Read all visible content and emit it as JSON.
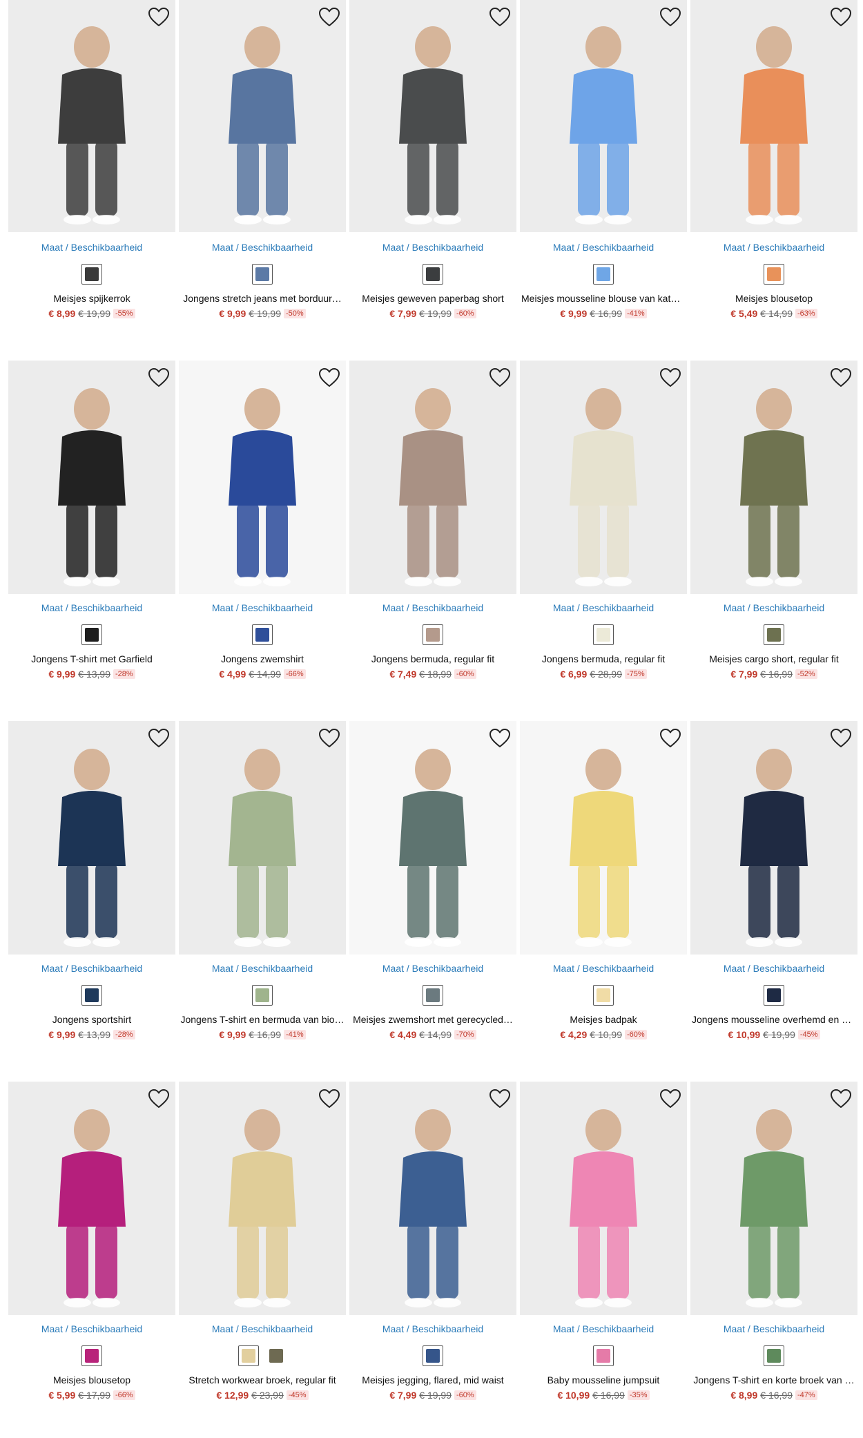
{
  "size_link_label": "Maat / Beschikbaarheid",
  "colors": {
    "link": "#2b7bb9",
    "sale_price": "#c0392b",
    "discount_bg": "#fbe3e3"
  },
  "products": [
    {
      "title": "Meisjes spijkerrok",
      "price": "€ 8,99",
      "old_price": "€ 19,99",
      "discount": "-55%",
      "swatches": [
        "#3a3a3a"
      ],
      "bg": "#ececec",
      "fg": "#3d3d3d"
    },
    {
      "title": "Jongens stretch jeans met borduur…",
      "price": "€ 9,99",
      "old_price": "€ 19,99",
      "discount": "-50%",
      "swatches": [
        "#5c7aa6"
      ],
      "bg": "#ededed",
      "fg": "#5875a0"
    },
    {
      "title": "Meisjes geweven paperbag short",
      "price": "€ 7,99",
      "old_price": "€ 19,99",
      "discount": "-60%",
      "swatches": [
        "#3b3d3f"
      ],
      "bg": "#ececec",
      "fg": "#4a4c4d"
    },
    {
      "title": "Meisjes mousseline blouse van katoen",
      "price": "€ 9,99",
      "old_price": "€ 16,99",
      "discount": "-41%",
      "swatches": [
        "#6fa6e6"
      ],
      "bg": "#ececec",
      "fg": "#6ea4e8"
    },
    {
      "title": "Meisjes blousetop",
      "price": "€ 5,49",
      "old_price": "€ 14,99",
      "discount": "-63%",
      "swatches": [
        "#e8925a"
      ],
      "bg": "#ececec",
      "fg": "#e98f5a"
    },
    {
      "title": "Jongens T-shirt met Garfield",
      "price": "€ 9,99",
      "old_price": "€ 13,99",
      "discount": "-28%",
      "swatches": [
        "#1e1e1e"
      ],
      "bg": "#ececec",
      "fg": "#222222"
    },
    {
      "title": "Jongens zwemshirt",
      "price": "€ 4,99",
      "old_price": "€ 14,99",
      "discount": "-66%",
      "swatches": [
        "#2f4f9a"
      ],
      "bg": "#f6f6f6",
      "fg": "#2a4a9a"
    },
    {
      "title": "Jongens bermuda, regular fit",
      "price": "€ 7,49",
      "old_price": "€ 18,99",
      "discount": "-60%",
      "swatches": [
        "#b49a8c"
      ],
      "bg": "#ececec",
      "fg": "#a99184"
    },
    {
      "title": "Jongens bermuda, regular fit",
      "price": "€ 6,99",
      "old_price": "€ 28,99",
      "discount": "-75%",
      "swatches": [
        "#ecead8"
      ],
      "bg": "#ececec",
      "fg": "#e6e2cf"
    },
    {
      "title": "Meisjes cargo short, regular fit",
      "price": "€ 7,99",
      "old_price": "€ 16,99",
      "discount": "-52%",
      "swatches": [
        "#6d7150"
      ],
      "bg": "#ececec",
      "fg": "#6f7350"
    },
    {
      "title": "Jongens sportshirt",
      "price": "€ 9,99",
      "old_price": "€ 13,99",
      "discount": "-28%",
      "swatches": [
        "#1f3a5c"
      ],
      "bg": "#ececec",
      "fg": "#1c3455"
    },
    {
      "title": "Jongens T-shirt en bermuda van bio…",
      "price": "€ 9,99",
      "old_price": "€ 16,99",
      "discount": "-41%",
      "swatches": [
        "#9fb48c"
      ],
      "bg": "#ececec",
      "fg": "#a3b590"
    },
    {
      "title": "Meisjes zwemshort met gerecycled…",
      "price": "€ 4,49",
      "old_price": "€ 14,99",
      "discount": "-70%",
      "swatches": [
        "#6b7a7f"
      ],
      "bg": "#f7f7f7",
      "fg": "#5e7470"
    },
    {
      "title": "Meisjes badpak",
      "price": "€ 4,29",
      "old_price": "€ 10,99",
      "discount": "-60%",
      "swatches": [
        "#f0dca6"
      ],
      "bg": "#f6f6f6",
      "fg": "#eed87a"
    },
    {
      "title": "Jongens mousseline overhemd en b…",
      "price": "€ 10,99",
      "old_price": "€ 19,99",
      "discount": "-45%",
      "swatches": [
        "#1e2a44"
      ],
      "bg": "#ececec",
      "fg": "#1f2a42"
    },
    {
      "title": "Meisjes blousetop",
      "price": "€ 5,99",
      "old_price": "€ 17,99",
      "discount": "-66%",
      "swatches": [
        "#b8237a"
      ],
      "bg": "#ececec",
      "fg": "#b51f7c"
    },
    {
      "title": "Stretch workwear broek, regular fit",
      "price": "€ 12,99",
      "old_price": "€ 23,99",
      "discount": "-45%",
      "swatches": [
        "#e2cf9e",
        "#6e6a52"
      ],
      "bg": "#ececec",
      "fg": "#e0cd98"
    },
    {
      "title": "Meisjes jegging, flared, mid waist",
      "price": "€ 7,99",
      "old_price": "€ 19,99",
      "discount": "-60%",
      "swatches": [
        "#35558a"
      ],
      "bg": "#ececec",
      "fg": "#3c5f92"
    },
    {
      "title": "Baby mousseline jumpsuit",
      "price": "€ 10,99",
      "old_price": "€ 16,99",
      "discount": "-35%",
      "swatches": [
        "#e57ba8"
      ],
      "bg": "#ececec",
      "fg": "#ee86b4"
    },
    {
      "title": "Jongens T-shirt en korte broek van …",
      "price": "€ 8,99",
      "old_price": "€ 16,99",
      "discount": "-47%",
      "swatches": [
        "#5e8a5c"
      ],
      "bg": "#ececec",
      "fg": "#6e9a68"
    }
  ]
}
